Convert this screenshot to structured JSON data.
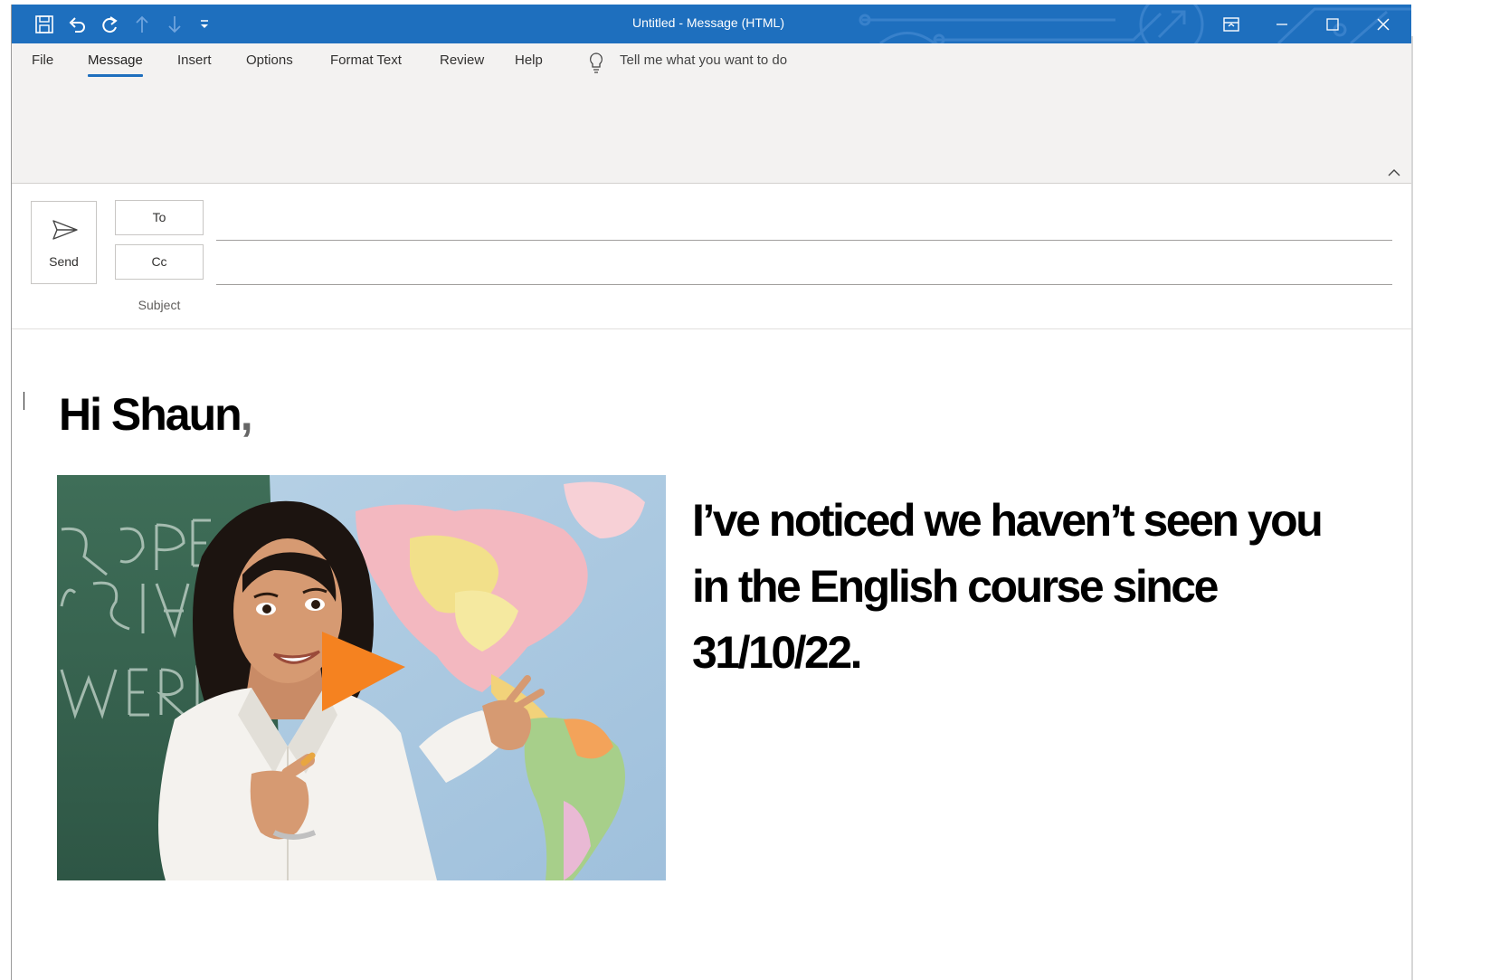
{
  "window": {
    "title": "Untitled  -  Message (HTML)"
  },
  "ribbon": {
    "tabs": [
      {
        "label": "File"
      },
      {
        "label": "Message",
        "active": true
      },
      {
        "label": "Insert"
      },
      {
        "label": "Options"
      },
      {
        "label": "Format Text"
      },
      {
        "label": "Review"
      },
      {
        "label": "Help"
      }
    ],
    "tell_me": "Tell me what you want to do"
  },
  "header": {
    "send_label": "Send",
    "to_label": "To",
    "cc_label": "Cc",
    "subject_label": "Subject"
  },
  "body": {
    "greeting_name": "Hi  Shaun",
    "greeting_punct": ",",
    "message_lines": [
      "I’ve noticed we haven’t seen you",
      "in the  English  course since",
      "31/10/22."
    ]
  },
  "icons": {
    "qat": [
      "save-icon",
      "undo-icon",
      "redo-icon",
      "previous-item-icon",
      "next-item-icon",
      "customize-qat-icon"
    ],
    "window": [
      "ribbon-display-options-icon",
      "minimize-icon",
      "maximize-icon",
      "close-icon"
    ]
  },
  "colors": {
    "title_bar": "#1e6fbe",
    "ribbon_bg": "#f3f2f1",
    "play_button": "#f58220"
  }
}
